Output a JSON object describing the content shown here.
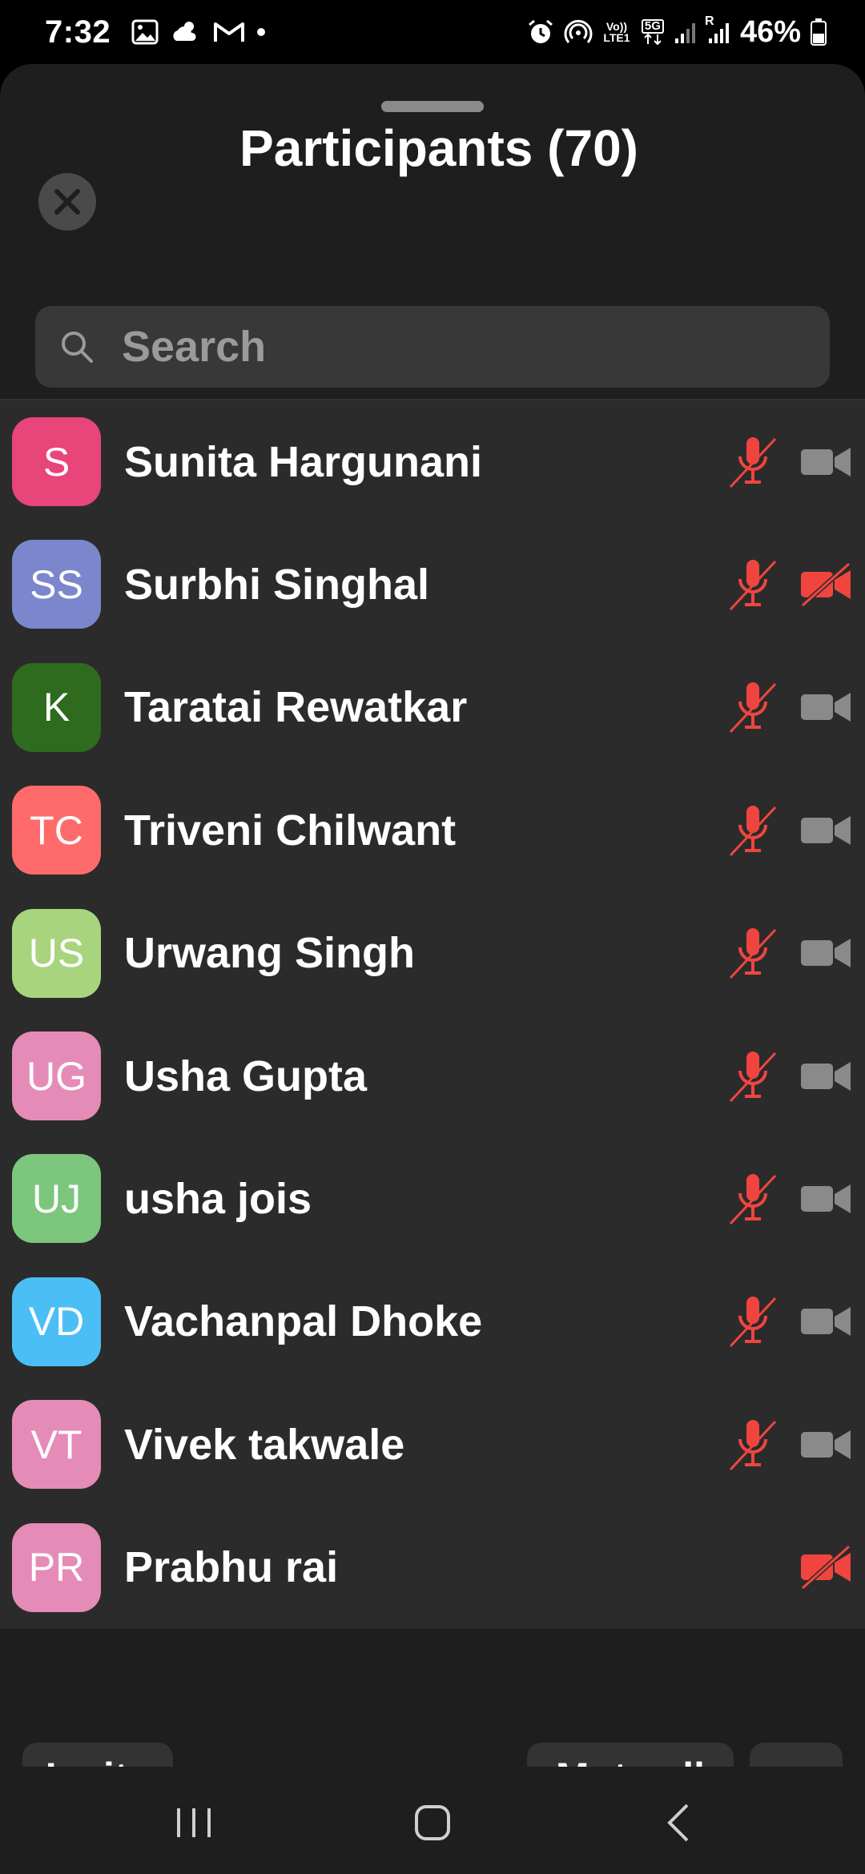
{
  "status_bar": {
    "time": "7:32",
    "volte_label": "Vo)) LTE1",
    "network_label": "5G",
    "roaming_label": "R",
    "battery": "46%"
  },
  "sheet": {
    "title": "Participants (70)",
    "search_placeholder": "Search"
  },
  "participants": [
    {
      "initials": "S",
      "name": "Sunita Hargunani",
      "color": "#E8457A",
      "mic": "muted",
      "video": "off"
    },
    {
      "initials": "SS",
      "name": "Surbhi Singhal",
      "color": "#7B86CC",
      "mic": "muted",
      "video": "muted"
    },
    {
      "initials": "K",
      "name": "Taratai Rewatkar",
      "color": "#2E6B1E",
      "mic": "muted",
      "video": "off"
    },
    {
      "initials": "TC",
      "name": "Triveni Chilwant",
      "color": "#FF6B6B",
      "mic": "muted",
      "video": "off"
    },
    {
      "initials": "US",
      "name": "Urwang Singh",
      "color": "#A8D47E",
      "mic": "muted",
      "video": "off"
    },
    {
      "initials": "UG",
      "name": "Usha Gupta",
      "color": "#E58BB8",
      "mic": "muted",
      "video": "off"
    },
    {
      "initials": "UJ",
      "name": "usha jois",
      "color": "#7CC67E",
      "mic": "muted",
      "video": "off"
    },
    {
      "initials": "VD",
      "name": "Vachanpal Dhoke",
      "color": "#4BBFF5",
      "mic": "muted",
      "video": "off"
    },
    {
      "initials": "VT",
      "name": "Vivek takwale",
      "color": "#E58BB8",
      "mic": "muted",
      "video": "off"
    },
    {
      "initials": "PR",
      "name": "Prabhu rai",
      "color": "#E58BB8",
      "mic": "none",
      "video": "muted"
    }
  ],
  "actions": {
    "invite_label": "Invite",
    "mute_all_label": "Mute all",
    "more_label": "···"
  },
  "icons": {
    "close": "close-icon",
    "search": "search-icon",
    "mic_muted": "mic-muted-icon",
    "video_off": "video-icon",
    "video_muted": "video-muted-icon",
    "nav_recents": "recents-icon",
    "nav_home": "home-icon",
    "nav_back": "back-icon"
  },
  "colors": {
    "muted_red": "#F0453F",
    "video_gray": "#8A8A8A",
    "sheet_bg": "#1E1E1E",
    "list_bg": "#2B2B2B"
  }
}
